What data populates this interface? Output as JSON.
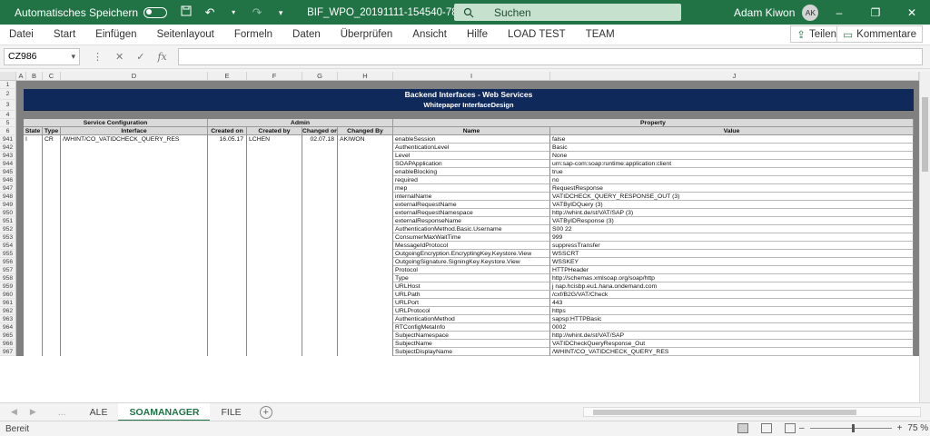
{
  "titlebar": {
    "autosave_label": "Automatisches Speichern",
    "filename": "BIF_WPO_20191111-154540-788.xls  -  Schreibgeschützt  -  Ex...",
    "search_label": "Suchen",
    "user_name": "Adam Kiwon",
    "user_initials": "AK",
    "minimize": "–",
    "restore": "❐",
    "close": "✕"
  },
  "menu": {
    "items": [
      "Datei",
      "Start",
      "Einfügen",
      "Seitenlayout",
      "Formeln",
      "Daten",
      "Überprüfen",
      "Ansicht",
      "Hilfe",
      "LOAD TEST",
      "TEAM"
    ],
    "share_label": "Teilen",
    "comments_label": "Kommentare"
  },
  "formula": {
    "namebox": "CZ986",
    "cancel": "✕",
    "confirm": "✓",
    "fx": "fx",
    "value": ""
  },
  "columns": [
    "A",
    "B",
    "C",
    "D",
    "E",
    "F",
    "G",
    "H",
    "I",
    "J"
  ],
  "banner": {
    "title": "Backend Interfaces - Web Services",
    "subtitle": "Whitepaper InterfaceDesign"
  },
  "groups": {
    "service": "Service Configuration",
    "admin": "Admin",
    "property": "Property"
  },
  "headers": {
    "state": "State",
    "type": "Type",
    "interface": "Interface",
    "created_on": "Created on",
    "created_by": "Created by",
    "changed_on": "Changed on",
    "changed_by": "Changed By",
    "name": "Name",
    "value": "Value"
  },
  "record": {
    "state": "I",
    "type": "CR",
    "interface": "/WHINT/CO_VATIDCHECK_QUERY_RES",
    "created_on": "16.05.17",
    "created_by": "LCHEN",
    "changed_on": "02.07.18",
    "changed_by": "AKIWON"
  },
  "header_row_numbers": [
    "1",
    "2",
    "3",
    "4",
    "5",
    "6"
  ],
  "properties": [
    {
      "row": "941",
      "name": "enableSession",
      "value": "false"
    },
    {
      "row": "942",
      "name": "AuthenticationLevel",
      "value": "Basic"
    },
    {
      "row": "943",
      "name": "Level",
      "value": "None"
    },
    {
      "row": "944",
      "name": "SOAPApplication",
      "value": "urn:sap-com:soap:runtime:application:client"
    },
    {
      "row": "945",
      "name": "enableBlocking",
      "value": "true"
    },
    {
      "row": "946",
      "name": "required",
      "value": "no"
    },
    {
      "row": "947",
      "name": "mep",
      "value": "RequestResponse"
    },
    {
      "row": "948",
      "name": "internalName",
      "value": "VATIDCHECK_QUERY_RESPONSE_OUT (3)"
    },
    {
      "row": "949",
      "name": "externalRequestName",
      "value": "VATByIDQuery (3)"
    },
    {
      "row": "950",
      "name": "externalRequestNamespace",
      "value": "http://whint.de/st/VAT/SAP (3)"
    },
    {
      "row": "951",
      "name": "externalResponseName",
      "value": "VATByIDResponse (3)"
    },
    {
      "row": "952",
      "name": "AuthenticationMethod.Basic.Username",
      "value": "S00           22"
    },
    {
      "row": "953",
      "name": "ConsumerMaxWaitTime",
      "value": "999"
    },
    {
      "row": "954",
      "name": "MessageIdProtocol",
      "value": "suppressTransfer"
    },
    {
      "row": "955",
      "name": "OutgoingEncryption.EncryptingKey.Keystore.View",
      "value": "WSSCRT"
    },
    {
      "row": "956",
      "name": "OutgoingSignature.SigningKey.Keystore.View",
      "value": "WSSKEY"
    },
    {
      "row": "957",
      "name": "Protocol",
      "value": "HTTPHeader"
    },
    {
      "row": "958",
      "name": "Type",
      "value": "http://schemas.xmlsoap.org/soap/http"
    },
    {
      "row": "959",
      "name": "URLHost",
      "value": "j             nap.hcisbp.eu1.hana.ondemand.com"
    },
    {
      "row": "960",
      "name": "URLPath",
      "value": "/cxf/B2G/VAT/Check"
    },
    {
      "row": "961",
      "name": "URLPort",
      "value": "443"
    },
    {
      "row": "962",
      "name": "URLProtocol",
      "value": "https"
    },
    {
      "row": "963",
      "name": "AuthenticationMethod",
      "value": "sapsp:HTTPBasic"
    },
    {
      "row": "964",
      "name": "RTConfigMetaInfo",
      "value": "0002"
    },
    {
      "row": "965",
      "name": "SubjectNamespace",
      "value": "http://whint.de/st/VAT/SAP"
    },
    {
      "row": "966",
      "name": "SubjectName",
      "value": "VATIDCheckQueryResponse_Out"
    },
    {
      "row": "967",
      "name": "SubjectDisplayName",
      "value": "/WHINT/CO_VATIDCHECK_QUERY_RES"
    }
  ],
  "sheets": {
    "ellipsis": "...",
    "tabs": [
      "ALE",
      "SOAMANAGER",
      "FILE"
    ],
    "active": "SOAMANAGER"
  },
  "status": {
    "ready": "Bereit",
    "zoom": "75 %"
  },
  "colors": {
    "excel_green": "#217346",
    "banner_navy": "#0f2a5a",
    "frame_gray": "#808080"
  }
}
